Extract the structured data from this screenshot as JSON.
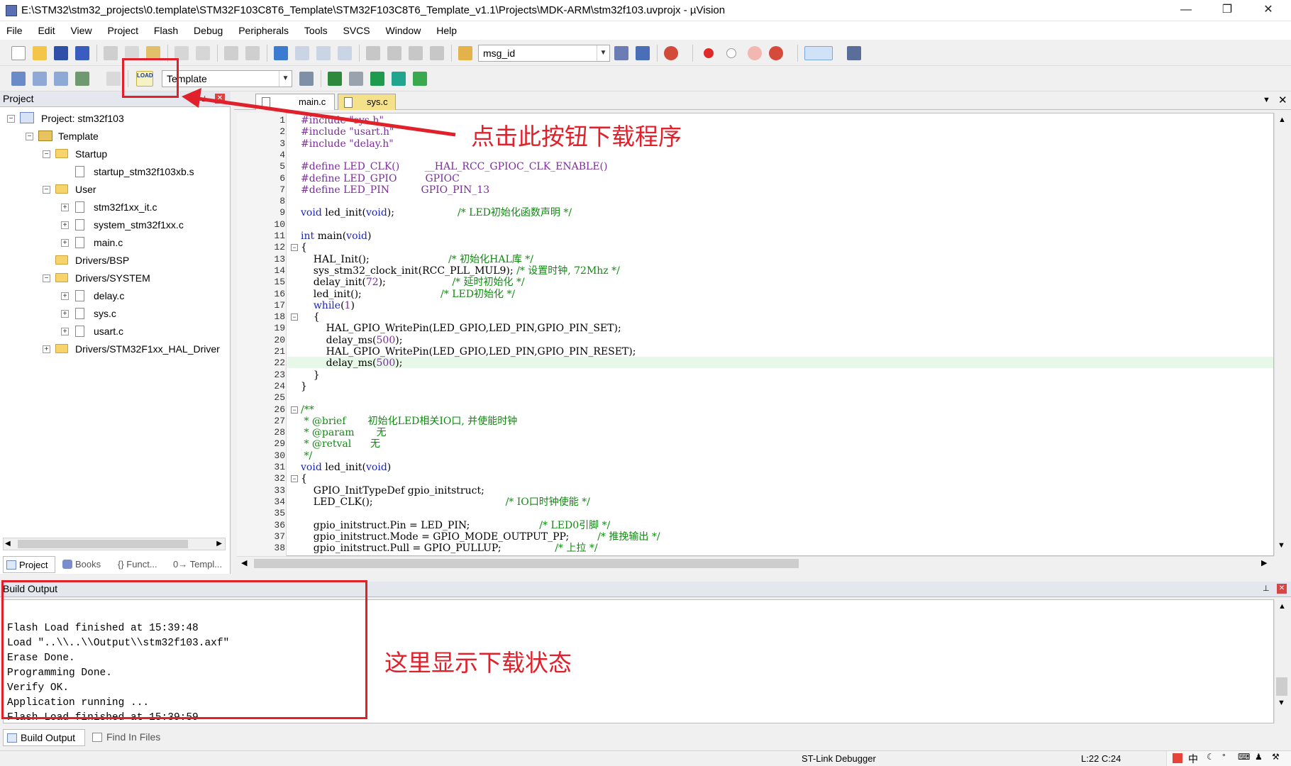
{
  "window": {
    "title": "E:\\STM32\\stm32_projects\\0.template\\STM32F103C8T6_Template\\STM32F103C8T6_Template_v1.1\\Projects\\MDK-ARM\\stm32f103.uvprojx - µVision",
    "minimize": "—",
    "restore": "❐",
    "close": "✕"
  },
  "menu": [
    "File",
    "Edit",
    "View",
    "Project",
    "Flash",
    "Debug",
    "Peripherals",
    "Tools",
    "SVCS",
    "Window",
    "Help"
  ],
  "toolbar1": {
    "find_combo_value": "msg_id"
  },
  "toolbar2": {
    "load_label": "LOAD",
    "target_combo_value": "Template"
  },
  "project_panel": {
    "header": "Project",
    "tree": [
      {
        "label": "Project: stm32f103",
        "level": 0,
        "type": "project",
        "toggle": "−"
      },
      {
        "label": "Template",
        "level": 1,
        "type": "target",
        "toggle": "−"
      },
      {
        "label": "Startup",
        "level": 2,
        "type": "folder",
        "toggle": "−"
      },
      {
        "label": "startup_stm32f103xb.s",
        "level": 3,
        "type": "file",
        "toggle": ""
      },
      {
        "label": "User",
        "level": 2,
        "type": "folder",
        "toggle": "−"
      },
      {
        "label": "stm32f1xx_it.c",
        "level": 3,
        "type": "file",
        "toggle": "+"
      },
      {
        "label": "system_stm32f1xx.c",
        "level": 3,
        "type": "file",
        "toggle": "+"
      },
      {
        "label": "main.c",
        "level": 3,
        "type": "file",
        "toggle": "+"
      },
      {
        "label": "Drivers/BSP",
        "level": 2,
        "type": "folder",
        "toggle": ""
      },
      {
        "label": "Drivers/SYSTEM",
        "level": 2,
        "type": "folder",
        "toggle": "−"
      },
      {
        "label": "delay.c",
        "level": 3,
        "type": "file",
        "toggle": "+"
      },
      {
        "label": "sys.c",
        "level": 3,
        "type": "file",
        "toggle": "+"
      },
      {
        "label": "usart.c",
        "level": 3,
        "type": "file",
        "toggle": "+"
      },
      {
        "label": "Drivers/STM32F1xx_HAL_Driver",
        "level": 2,
        "type": "folder",
        "toggle": "+"
      }
    ],
    "bottom_tabs": [
      "Project",
      "Books",
      "{} Funct...",
      "0→ Templ..."
    ]
  },
  "editor": {
    "tabs": [
      "main.c",
      "sys.c"
    ],
    "active_tab": "main.c",
    "highlighted_line": 22,
    "lines": [
      "#include \"sys.h\"",
      "#include \"usart.h\"",
      "#include \"delay.h\"",
      "",
      "#define LED_CLK()        __HAL_RCC_GPIOC_CLK_ENABLE()",
      "#define LED_GPIO         GPIOC",
      "#define LED_PIN          GPIO_PIN_13",
      "",
      "void led_init(void);                    /* LED初始化函数声明 */",
      "",
      "int main(void)",
      "{",
      "    HAL_Init();                         /* 初始化HAL库 */",
      "    sys_stm32_clock_init(RCC_PLL_MUL9); /* 设置时钟, 72Mhz */",
      "    delay_init(72);                     /* 延时初始化 */",
      "    led_init();                         /* LED初始化 */",
      "    while(1)",
      "    {",
      "        HAL_GPIO_WritePin(LED_GPIO,LED_PIN,GPIO_PIN_SET);",
      "        delay_ms(500);",
      "        HAL_GPIO_WritePin(LED_GPIO,LED_PIN,GPIO_PIN_RESET);",
      "        delay_ms(500);",
      "    }",
      "}",
      "",
      "/**",
      " * @brief       初始化LED相关IO口, 并使能时钟",
      " * @param       无",
      " * @retval      无",
      " */",
      "void led_init(void)",
      "{",
      "    GPIO_InitTypeDef gpio_initstruct;",
      "    LED_CLK();                                          /* IO口时钟使能 */",
      "",
      "    gpio_initstruct.Pin = LED_PIN;                      /* LED0引脚 */",
      "    gpio_initstruct.Mode = GPIO_MODE_OUTPUT_PP;         /* 推挽输出 */",
      "    gpio_initstruct.Pull = GPIO_PULLUP;                 /* 上拉 */"
    ]
  },
  "build_output": {
    "header": "Build Output",
    "lines": [
      "Flash Load finished at 15:39:48",
      "Load \"..\\\\..\\\\Output\\\\stm32f103.axf\"",
      "Erase Done.",
      "Programming Done.",
      "Verify OK.",
      "Application running ...",
      "Flash Load finished at 15:39:59"
    ],
    "tabs": [
      "Build Output",
      "Find In Files"
    ]
  },
  "status": {
    "debugger": "ST-Link Debugger",
    "cursor": "L:22 C:24",
    "ime": "中"
  },
  "annotations": {
    "load_hint": "点击此按钮下载程序",
    "output_hint": "这里显示下载状态"
  },
  "colors": {
    "annotation_red": "#e0202a",
    "keyword_blue": "#1b26b9",
    "comment_green": "#0f8a0f",
    "highlight_line": "#e8f8e8"
  }
}
